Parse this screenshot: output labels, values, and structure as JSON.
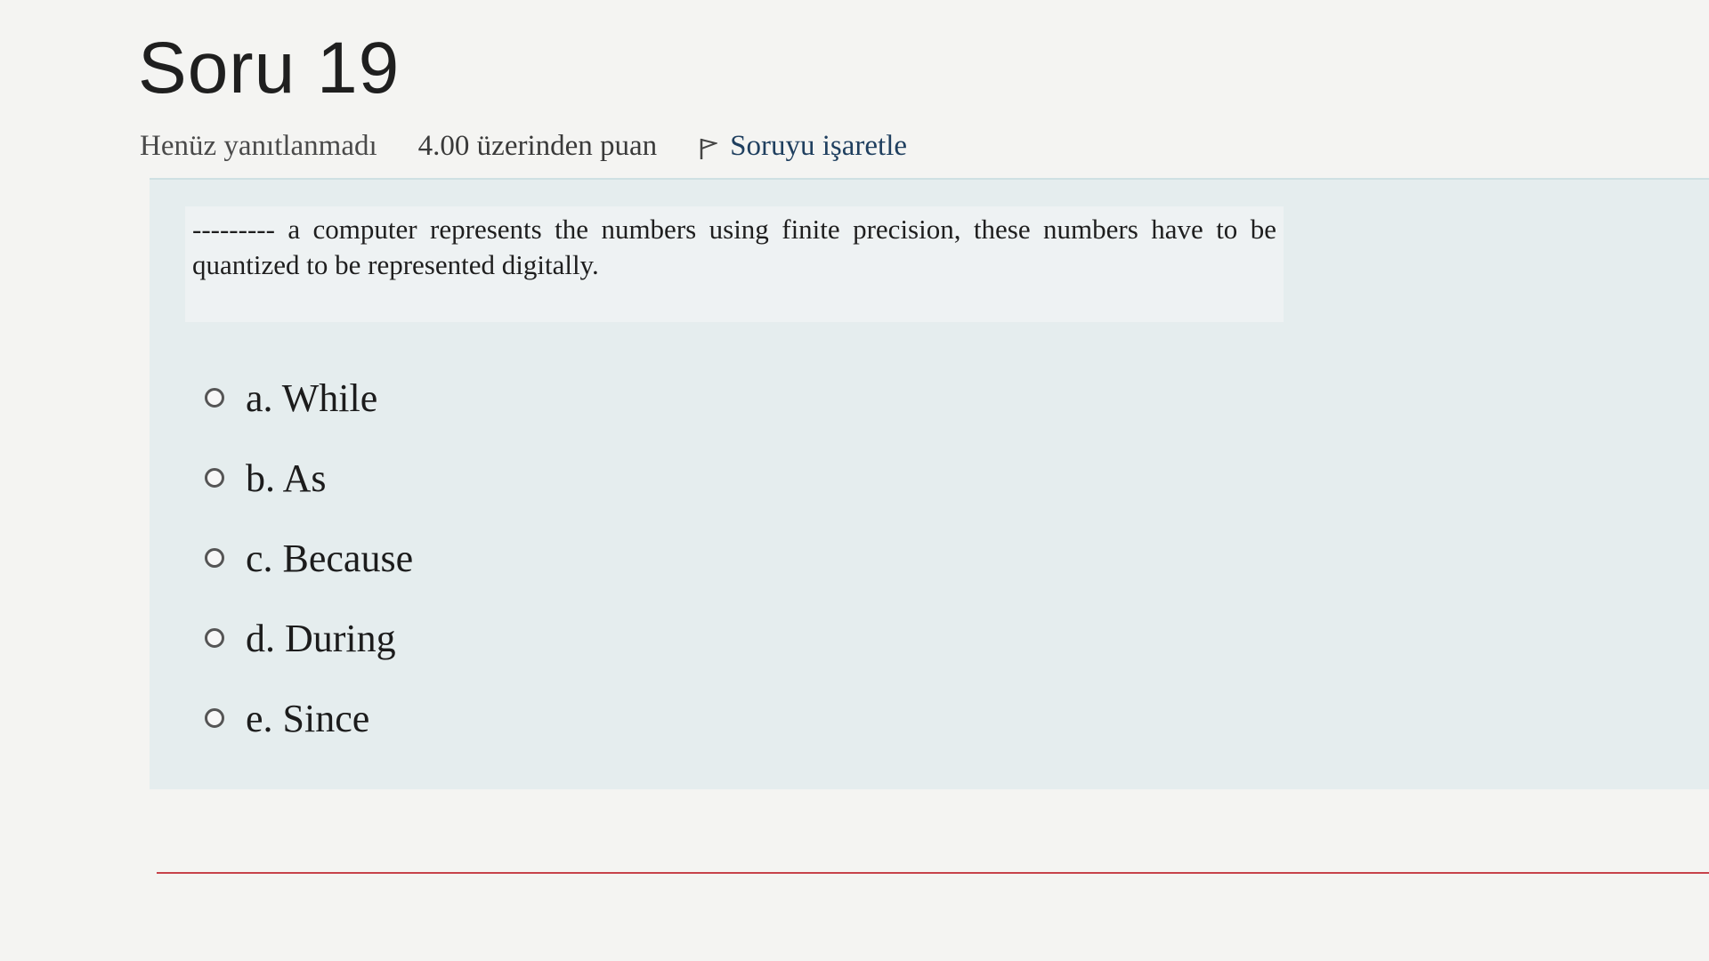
{
  "question": {
    "title": "Soru 19",
    "status": "Henüz yanıtlanmadı",
    "grade": "4.00 üzerinden puan",
    "flag_label": "Soruyu işaretle",
    "flag_icon": "flag-icon",
    "text": "--------- a computer represents the numbers using finite precision, these numbers have to be quantized to be represented digitally."
  },
  "answers": [
    {
      "label": "a. While"
    },
    {
      "label": "b. As"
    },
    {
      "label": "c. Because"
    },
    {
      "label": "d. During"
    },
    {
      "label": "e. Since"
    }
  ],
  "colors": {
    "panel_background": "#e5edee",
    "divider": "#c7434b"
  }
}
